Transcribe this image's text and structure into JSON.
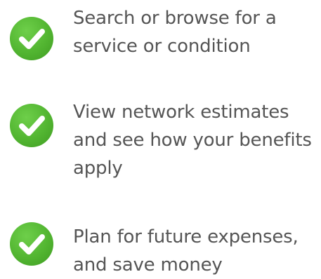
{
  "colors": {
    "check_green": "#52b531",
    "text_gray": "#555555"
  },
  "items": [
    {
      "icon": "check-circle-icon",
      "lines": [
        "Search or browse for a",
        "service or condition"
      ]
    },
    {
      "icon": "check-circle-icon",
      "lines": [
        "View network estimates",
        "and see how your benefits",
        "apply"
      ]
    },
    {
      "icon": "check-circle-icon",
      "lines": [
        "Plan for future expenses,",
        "and save money"
      ]
    }
  ]
}
